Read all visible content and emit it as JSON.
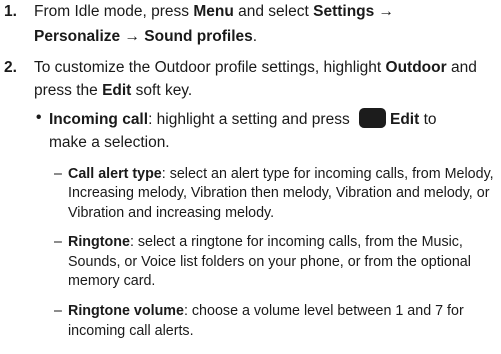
{
  "steps": [
    {
      "number": "1.",
      "line1_prefix": "From Idle mode, press ",
      "menu": "Menu",
      "line1_mid": " and select ",
      "settings": "Settings →",
      "line2": "Personalize → Sound profiles",
      "line2_end": "."
    },
    {
      "number": "2.",
      "line1_prefix": "To customize the Outdoor profile settings, highlight ",
      "outdoor": "Outdoor",
      "line1_suffix": " and",
      "line2_prefix": "press the ",
      "edit": "Edit",
      "line2_suffix": " soft key."
    }
  ],
  "bullet": {
    "marker": "•",
    "term": "Incoming call",
    "text1": ": highlight a setting and press ",
    "key_icon": "soft-key-icon",
    "key_label": "Edit",
    "text2": " to",
    "line2": "make a selection."
  },
  "sub_items": [
    {
      "marker": "–",
      "term": "Call alert type",
      "line1_rest": ": select an alert type for incoming calls, from Melody,",
      "line2": "Increasing melody, Vibration then melody, Vibration and melody, or",
      "line3": "Vibration and increasing melody."
    },
    {
      "marker": "–",
      "term": "Ringtone",
      "line1_rest": ": select a ringtone for incoming calls, from the Music,",
      "line2": "Sounds, or Voice list folders on your phone, or from the optional",
      "line3": "memory card."
    },
    {
      "marker": "–",
      "term": "Ringtone volume",
      "line1_rest": ": choose a volume level between 1 and 7 for",
      "line2": "incoming call alerts."
    }
  ]
}
